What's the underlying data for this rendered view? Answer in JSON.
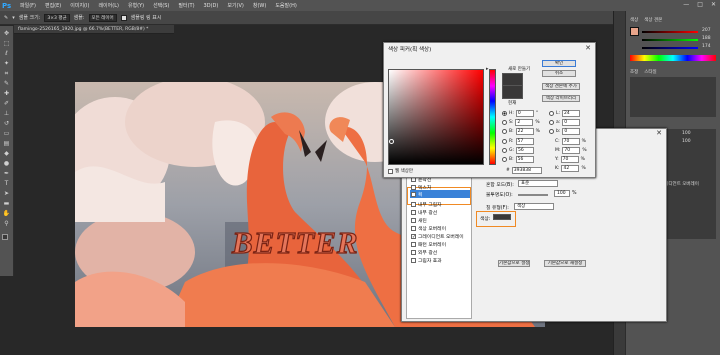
{
  "menubar": {
    "logo": "Ps",
    "items": [
      "파일(F)",
      "편집(E)",
      "이미지(I)",
      "레이어(L)",
      "유형(Y)",
      "선택(S)",
      "필터(T)",
      "3D(D)",
      "보기(V)",
      "창(W)",
      "도움말(H)"
    ],
    "window_controls": [
      "—",
      "□",
      "✕"
    ]
  },
  "options": {
    "sample_size_label": "샘플 크기:",
    "sample_size_value": "3×3 평균",
    "sample_label": "샘플:",
    "sample_value": "모든 레이어",
    "show_ring_label": "샘플링 링 표시"
  },
  "document": {
    "tab_title": "flamingo-2526165_1920.jpg @ 66.7%(BETTER, RGB/8#) *"
  },
  "canvas": {
    "text": "BETTER"
  },
  "right_panel": {
    "color_tab": "색상",
    "swatches_tab": "색상 견본",
    "adjust_tab": "조정",
    "styles_tab": "스타일",
    "fx_label": "효과",
    "layer_name": "그레이디언트 오버레이",
    "new_style_button": "새 스타일(W)...",
    "preview_label": "미리 보기(V)",
    "fill_value": "100",
    "opacity_value": "100",
    "slider_values": [
      "207",
      "188",
      "174"
    ]
  },
  "color_picker": {
    "title": "색상 피커(획 색상)",
    "ok": "확인",
    "cancel": "취소",
    "add_to_swatches": "색상 견본에 추가",
    "color_libraries": "색상 라이브러리",
    "new_label": "새로 만들기",
    "current_label": "현재",
    "web_only": "웹 색상만",
    "hex_symbol": "#",
    "hex": "393838",
    "fields": {
      "H": {
        "label": "H:",
        "value": "0",
        "unit": "°"
      },
      "S": {
        "label": "S:",
        "value": "2",
        "unit": "%"
      },
      "B": {
        "label": "B:",
        "value": "22",
        "unit": "%"
      },
      "R": {
        "label": "R:",
        "value": "57",
        "unit": ""
      },
      "G": {
        "label": "G:",
        "value": "56",
        "unit": ""
      },
      "Bl": {
        "label": "B:",
        "value": "56",
        "unit": ""
      },
      "L": {
        "label": "L:",
        "value": "24",
        "unit": ""
      },
      "a": {
        "label": "a:",
        "value": "0",
        "unit": ""
      },
      "b": {
        "label": "b:",
        "value": "0",
        "unit": ""
      },
      "C": {
        "label": "C:",
        "value": "70",
        "unit": "%"
      },
      "M": {
        "label": "M:",
        "value": "70",
        "unit": "%"
      },
      "Y": {
        "label": "Y:",
        "value": "70",
        "unit": "%"
      },
      "K": {
        "label": "K:",
        "value": "42",
        "unit": "%"
      }
    },
    "colors": {
      "current": "#393838",
      "hue_marker_border": "#555555"
    }
  },
  "layer_style": {
    "ok": "확인",
    "cancel": "취소",
    "list": [
      {
        "label": "윤곽선",
        "checked": false
      },
      {
        "label": "텍스처",
        "checked": false
      },
      {
        "label": "획",
        "checked": true,
        "selected": true
      },
      {
        "label": "내부 그림자",
        "checked": false
      },
      {
        "label": "내부 광선",
        "checked": false
      },
      {
        "label": "새틴",
        "checked": false
      },
      {
        "label": "색상 오버레이",
        "checked": false
      },
      {
        "label": "그레이디언트 오버레이",
        "checked": true
      },
      {
        "label": "패턴 오버레이",
        "checked": false
      },
      {
        "label": "외부 광선",
        "checked": false
      },
      {
        "label": "그림자 효과",
        "checked": false
      }
    ],
    "blend_mode_label": "혼합 모드(B):",
    "blend_mode_value": "표준",
    "opacity_label": "불투명도(O):",
    "opacity_value": "100",
    "opacity_unit": "%",
    "fill_type_label": "칠 유형(F):",
    "fill_type_value": "색상",
    "color_label": "색상:",
    "color_swatch": "#393838",
    "make_default": "기본값으로 설정",
    "reset_default": "기본값으로 재설정"
  }
}
